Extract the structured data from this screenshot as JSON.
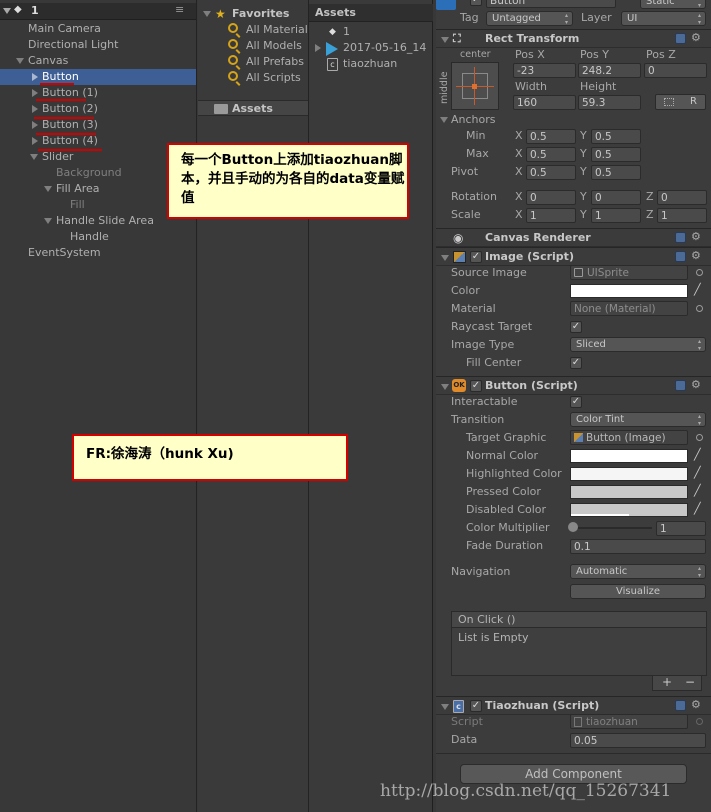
{
  "hierarchy": {
    "scene": "1",
    "items": [
      {
        "label": "Main Camera"
      },
      {
        "label": "Directional Light"
      },
      {
        "label": "Canvas"
      },
      {
        "label": "Button"
      },
      {
        "label": "Button (1)"
      },
      {
        "label": "Button (2)"
      },
      {
        "label": "Button (3)"
      },
      {
        "label": "Button (4)"
      },
      {
        "label": "Slider"
      },
      {
        "label": "Background"
      },
      {
        "label": "Fill Area"
      },
      {
        "label": "Fill"
      },
      {
        "label": "Handle Slide Area"
      },
      {
        "label": "Handle"
      },
      {
        "label": "EventSystem"
      }
    ]
  },
  "project": {
    "favorites_label": "Favorites",
    "favorites": [
      "All Material",
      "All Models",
      "All Prefabs",
      "All Scripts"
    ],
    "assets_label": "Assets",
    "assets_header": "Assets",
    "assets_items": [
      "1",
      "2017-05-16_14",
      "tiaozhuan"
    ]
  },
  "notes": {
    "note1": "每一个Button上添加tiaozhuan脚本，并且手动的为各自的data变量赋值",
    "note2": "FR:徐海涛（hunk Xu)"
  },
  "inspector": {
    "object_name": "Button",
    "static_label": "Static",
    "tag_label": "Tag",
    "tag_value": "Untagged",
    "layer_label": "Layer",
    "layer_value": "UI",
    "rect_transform": {
      "title": "Rect Transform",
      "anchor_h": "center",
      "anchor_v": "middle",
      "pos_x_label": "Pos X",
      "pos_y_label": "Pos Y",
      "pos_z_label": "Pos Z",
      "pos_x": "-23",
      "pos_y": "248.2",
      "pos_z": "0",
      "width_label": "Width",
      "height_label": "Height",
      "width": "160",
      "height": "59.3",
      "r_button": "R",
      "anchors_label": "Anchors",
      "min_label": "Min",
      "max_label": "Max",
      "min_x": "0.5",
      "min_y": "0.5",
      "max_x": "0.5",
      "max_y": "0.5",
      "pivot_label": "Pivot",
      "pivot_x": "0.5",
      "pivot_y": "0.5",
      "rotation_label": "Rotation",
      "rot_x": "0",
      "rot_y": "0",
      "rot_z": "0",
      "scale_label": "Scale",
      "scale_x": "1",
      "scale_y": "1",
      "scale_z": "1",
      "axis_x": "X",
      "axis_y": "Y",
      "axis_z": "Z"
    },
    "canvas_renderer": {
      "title": "Canvas Renderer"
    },
    "image": {
      "title": "Image (Script)",
      "source_image_label": "Source Image",
      "source_image": "UISprite",
      "color_label": "Color",
      "material_label": "Material",
      "material": "None (Material)",
      "raycast_label": "Raycast Target",
      "image_type_label": "Image Type",
      "image_type": "Sliced",
      "fill_center_label": "Fill Center"
    },
    "button": {
      "title": "Button (Script)",
      "interactable_label": "Interactable",
      "transition_label": "Transition",
      "transition": "Color Tint",
      "target_graphic_label": "Target Graphic",
      "target_graphic": "Button (Image)",
      "normal_label": "Normal Color",
      "highlighted_label": "Highlighted Color",
      "pressed_label": "Pressed Color",
      "disabled_label": "Disabled Color",
      "multiplier_label": "Color Multiplier",
      "multiplier": "1",
      "fade_label": "Fade Duration",
      "fade": "0.1",
      "navigation_label": "Navigation",
      "navigation": "Automatic",
      "visualize": "Visualize",
      "onclick_label": "On Click ()",
      "list_empty": "List is Empty",
      "plus": "+",
      "minus": "−"
    },
    "tiaozhuan": {
      "title": "Tiaozhuan (Script)",
      "script_label": "Script",
      "script": "tiaozhuan",
      "data_label": "Data",
      "data": "0.05"
    },
    "add_component": "Add Component"
  },
  "watermark": "http://blog.csdn.net/qq_15267341",
  "colors": {
    "normal": "#ffffff",
    "highlighted": "#f5f5f5",
    "pressed": "#c8c8c8",
    "disabled": "#c8c8c8",
    "selection": "#3e5f96",
    "note_border": "#d40000"
  }
}
